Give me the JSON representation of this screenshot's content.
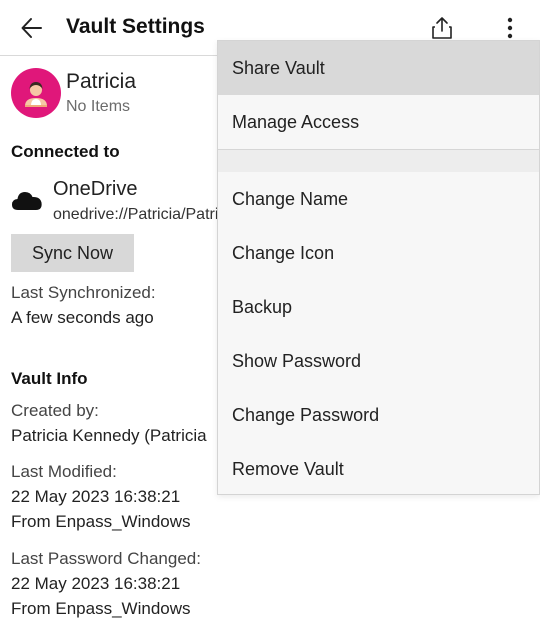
{
  "header": {
    "title": "Vault Settings",
    "back_icon": "arrow-left-icon",
    "share_icon": "share-upload-icon",
    "more_icon": "more-vertical-icon"
  },
  "profile": {
    "name": "Patricia",
    "items": "No Items",
    "avatar_color": "#e0177a"
  },
  "connection": {
    "heading": "Connected to",
    "service": "OneDrive",
    "path": "onedrive://Patricia/Patricia",
    "sync_button": "Sync Now",
    "last_sync_label": "Last Synchronized:",
    "last_sync_value": "A few seconds ago"
  },
  "vault_info": {
    "heading": "Vault Info",
    "created_by_label": "Created by:",
    "created_by_value": "Patricia Kennedy (Patricia",
    "last_modified_label": "Last Modified:",
    "last_modified_date": "22 May 2023 16:38:21",
    "last_modified_from": "From Enpass_Windows",
    "last_pw_label": "Last Password Changed:",
    "last_pw_date": "22 May 2023 16:38:21",
    "last_pw_from": "From Enpass_Windows"
  },
  "menu": {
    "items": [
      "Share Vault",
      "Manage Access",
      "Change Name",
      "Change Icon",
      "Backup",
      "Show Password",
      "Change Password",
      "Remove Vault"
    ],
    "highlighted": "Share Vault"
  }
}
